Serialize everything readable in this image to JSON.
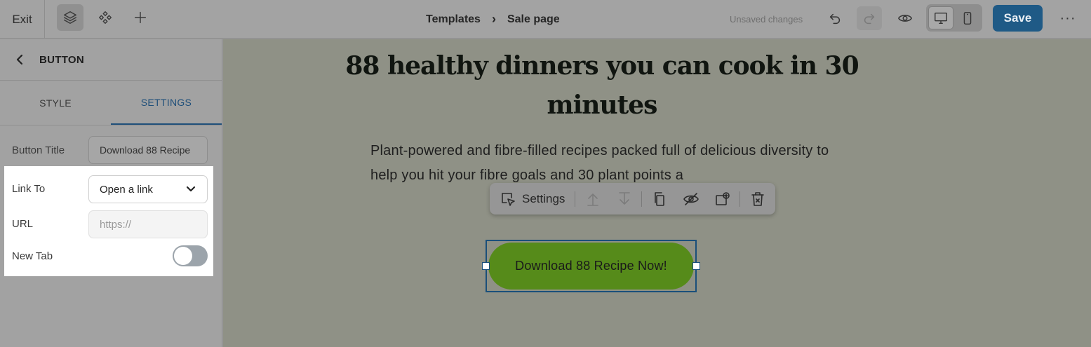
{
  "topbar": {
    "exit_label": "Exit",
    "breadcrumb": [
      "Templates",
      "Sale page"
    ],
    "breadcrumb_separator": "›",
    "status_text": "Unsaved changes",
    "save_label": "Save",
    "more_label": "···",
    "accent_color": "#1f5a86"
  },
  "sidebar": {
    "panel_title": "BUTTON",
    "tabs": [
      {
        "label": "STYLE",
        "active": false
      },
      {
        "label": "SETTINGS",
        "active": true
      }
    ],
    "button_title": {
      "label": "Button Title",
      "value": "Download 88 Recipe"
    },
    "link_to": {
      "label": "Link To",
      "value": "Open a link"
    },
    "url": {
      "label": "URL",
      "placeholder": "https://",
      "value": ""
    },
    "new_tab": {
      "label": "New Tab",
      "enabled": false
    }
  },
  "canvas": {
    "headline": "88 healthy dinners you can cook in 30 minutes",
    "subtext": "Plant-powered and fibre-filled recipes packed full of delicious diversity to help you hit your fibre goals and 30 plant points a",
    "toolbar": {
      "settings_label": "Settings"
    },
    "cta_label": "Download 88 Recipe Now!",
    "cta_color": "#568b1a"
  }
}
